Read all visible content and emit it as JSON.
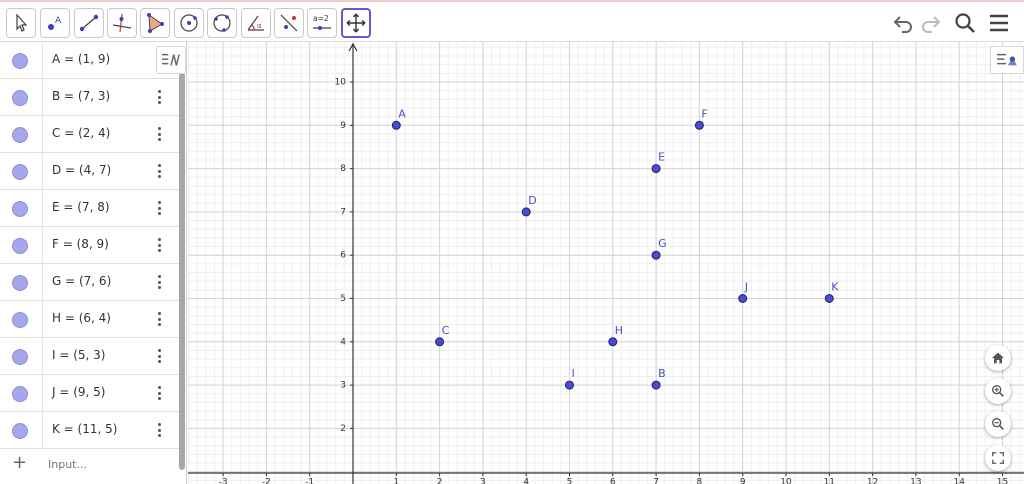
{
  "toolbar": {
    "tools": [
      {
        "name": "move-tool",
        "icon": "cursor-arrow-icon"
      },
      {
        "name": "point-tool",
        "icon": "point-icon",
        "label": "A"
      },
      {
        "name": "segment-tool",
        "icon": "segment-icon"
      },
      {
        "name": "perpendicular-line-tool",
        "icon": "perpendicular-icon"
      },
      {
        "name": "polygon-tool",
        "icon": "polygon-icon"
      },
      {
        "name": "circle-center-point-tool",
        "icon": "circle-center-icon"
      },
      {
        "name": "circle-three-points-tool",
        "icon": "circle-three-points-icon"
      },
      {
        "name": "angle-tool",
        "icon": "angle-icon",
        "label": "α"
      },
      {
        "name": "reflect-tool",
        "icon": "reflect-icon"
      },
      {
        "name": "slider-tool",
        "icon": "slider-icon",
        "label": "a=2"
      },
      {
        "name": "move-graphics-tool",
        "icon": "move-graphics-icon"
      }
    ],
    "accent": "#6557d2"
  },
  "algebra": {
    "items": [
      {
        "name": "A",
        "expr": "A = (1, 9)"
      },
      {
        "name": "B",
        "expr": "B = (7, 3)"
      },
      {
        "name": "C",
        "expr": "C = (2, 4)"
      },
      {
        "name": "D",
        "expr": "D = (4, 7)"
      },
      {
        "name": "E",
        "expr": "E = (7, 8)"
      },
      {
        "name": "F",
        "expr": "F = (8, 9)"
      },
      {
        "name": "G",
        "expr": "G = (7, 6)"
      },
      {
        "name": "H",
        "expr": "H = (6, 4)"
      },
      {
        "name": "I",
        "expr": "I = (5, 3)"
      },
      {
        "name": "J",
        "expr": "J = (9, 5)"
      },
      {
        "name": "K",
        "expr": "K = (11, 5)"
      }
    ],
    "input_placeholder": "Input...",
    "plus": "+"
  },
  "graph": {
    "x_ticks": [
      -3,
      -2,
      -1,
      1,
      2,
      3,
      4,
      5,
      6,
      7,
      8,
      9,
      10,
      11,
      12,
      13,
      14,
      15
    ],
    "y_ticks": [
      2,
      3,
      4,
      5,
      6,
      7,
      8,
      9,
      10
    ],
    "points": [
      {
        "label": "A",
        "x": 1,
        "y": 9
      },
      {
        "label": "B",
        "x": 7,
        "y": 3
      },
      {
        "label": "C",
        "x": 2,
        "y": 4
      },
      {
        "label": "D",
        "x": 4,
        "y": 7
      },
      {
        "label": "E",
        "x": 7,
        "y": 8
      },
      {
        "label": "F",
        "x": 8,
        "y": 9
      },
      {
        "label": "G",
        "x": 7,
        "y": 6
      },
      {
        "label": "H",
        "x": 6,
        "y": 4
      },
      {
        "label": "I",
        "x": 5,
        "y": 3
      },
      {
        "label": "J",
        "x": 9,
        "y": 5
      },
      {
        "label": "K",
        "x": 11,
        "y": 5
      }
    ],
    "point_color": "#4a4ad2"
  }
}
